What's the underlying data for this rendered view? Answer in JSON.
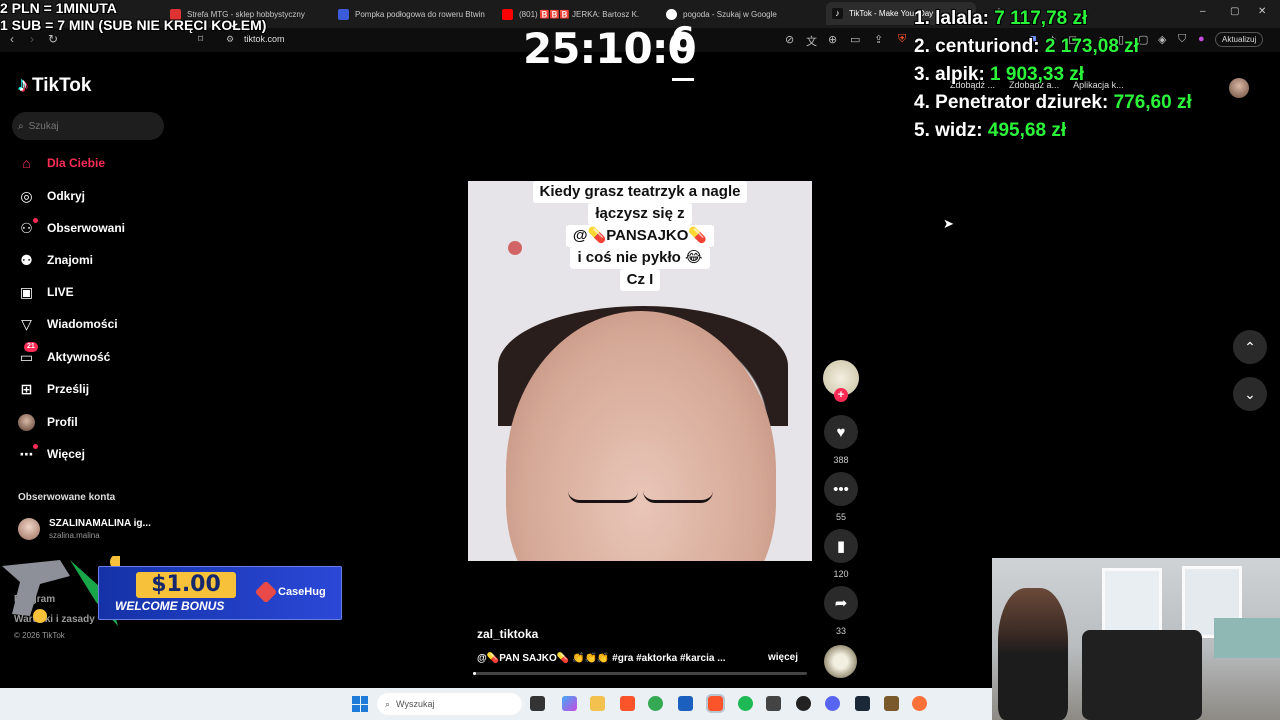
{
  "browser": {
    "tabs": [
      {
        "title": "Strefa MTG - sklep hobbystyczny",
        "icon": "store-icon",
        "color": "#d33"
      },
      {
        "title": "Pompka podłogowa do roweru Btwin",
        "icon": "cart-icon",
        "color": "#3b5bdb"
      },
      {
        "title": "(801) 🅱️🅱️🅱️ JERKA: Bartosz K.",
        "icon": "youtube-icon",
        "color": "#f00"
      },
      {
        "title": "pogoda - Szukaj w Google",
        "icon": "google-icon",
        "color": "#fff"
      },
      {
        "title": "TikTok - Make Your Day",
        "icon": "tiktok-icon",
        "color": "#111"
      }
    ],
    "url": "tiktok.com",
    "update_label": "Aktualizuj",
    "bookmarks": [
      "Zdobądź ...",
      "Zdobądź a...",
      "Aplikacja k..."
    ]
  },
  "overlay": {
    "line1": "2 PLN = 1MINUTA",
    "line2": "1 SUB = 7 MIN (SUB NIE KRĘCI KOŁEM)",
    "timer": "25:10:0",
    "timer_sup": "6",
    "leaderboard": [
      {
        "rank": "1.",
        "name": "lalala:",
        "amount": "7 117,78 zł"
      },
      {
        "rank": "2.",
        "name": "centuriond:",
        "amount": "2 173,08 zł"
      },
      {
        "rank": "3.",
        "name": "alpik:",
        "amount": "1 903,33 zł"
      },
      {
        "rank": "4.",
        "name": "Penetrator dziurek:",
        "amount": "776,60 zł"
      },
      {
        "rank": "5.",
        "name": "widz:",
        "amount": "495,68 zł"
      }
    ]
  },
  "tiktok": {
    "logo": "TikTok",
    "search_placeholder": "Szukaj",
    "menu": [
      {
        "label": "Dla Ciebie",
        "icon": "home-icon",
        "active": true
      },
      {
        "label": "Odkryj",
        "icon": "compass-icon"
      },
      {
        "label": "Obserwowani",
        "icon": "following-icon"
      },
      {
        "label": "Znajomi",
        "icon": "friends-icon"
      },
      {
        "label": "LIVE",
        "icon": "live-icon"
      },
      {
        "label": "Wiadomości",
        "icon": "messages-icon"
      },
      {
        "label": "Aktywność",
        "icon": "activity-icon",
        "badge": "21"
      },
      {
        "label": "Prześlij",
        "icon": "upload-icon"
      },
      {
        "label": "Profil",
        "icon": "profile-avatar"
      },
      {
        "label": "Więcej",
        "icon": "more-icon"
      }
    ],
    "followed_title": "Obserwowane konta",
    "followed": [
      {
        "name": "SZALINAMALINA ig...",
        "handle": "szalina.malina"
      }
    ],
    "footer_1": "Program",
    "footer_2": "Warunki i zasady",
    "copyright": "© 2026 TikTok",
    "video": {
      "caption": [
        "Kiedy grasz teatrzyk a nagle",
        "łączysz się z",
        "@💊PANSAJKO💊",
        "i coś nie pykło 😂",
        "Cz I"
      ],
      "author": "zal_tiktoka",
      "description": "@💊PAN SAJKO💊 👏👏👏 #gra #aktorka #karcia ...",
      "more": "więcej",
      "likes": "388",
      "comments": "55",
      "saves": "120",
      "shares": "33",
      "progress": 0.01
    }
  },
  "promo": {
    "amount": "$1.00",
    "text": "WELCOME BONUS",
    "brand": "CaseHug"
  },
  "taskbar": {
    "search_placeholder": "Wyszukaj"
  }
}
